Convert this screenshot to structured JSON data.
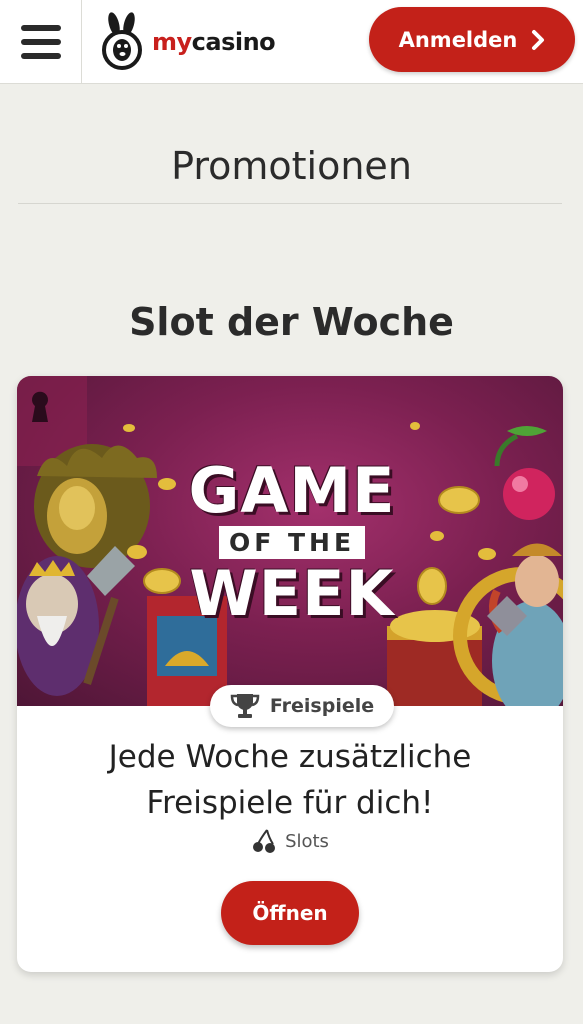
{
  "header": {
    "logo_my": "my",
    "logo_casino": "casino",
    "login_label": "Anmelden"
  },
  "page": {
    "title": "Promotionen",
    "section_title": "Slot der Woche"
  },
  "promo_card": {
    "banner_line1": "GAME",
    "banner_line2": "OF THE",
    "banner_line3": "WEEK",
    "badge_label": "Freispiele",
    "badge_icon": "trophy-icon",
    "headline_line1": "Jede Woche zusätzliche",
    "headline_line2": "Freispiele für dich!",
    "category_label": "Slots",
    "category_icon": "cherries-icon",
    "open_label": "Öffnen"
  },
  "colors": {
    "brand_red": "#c32119",
    "background": "#efefea",
    "banner_purple": "#7b2050"
  }
}
